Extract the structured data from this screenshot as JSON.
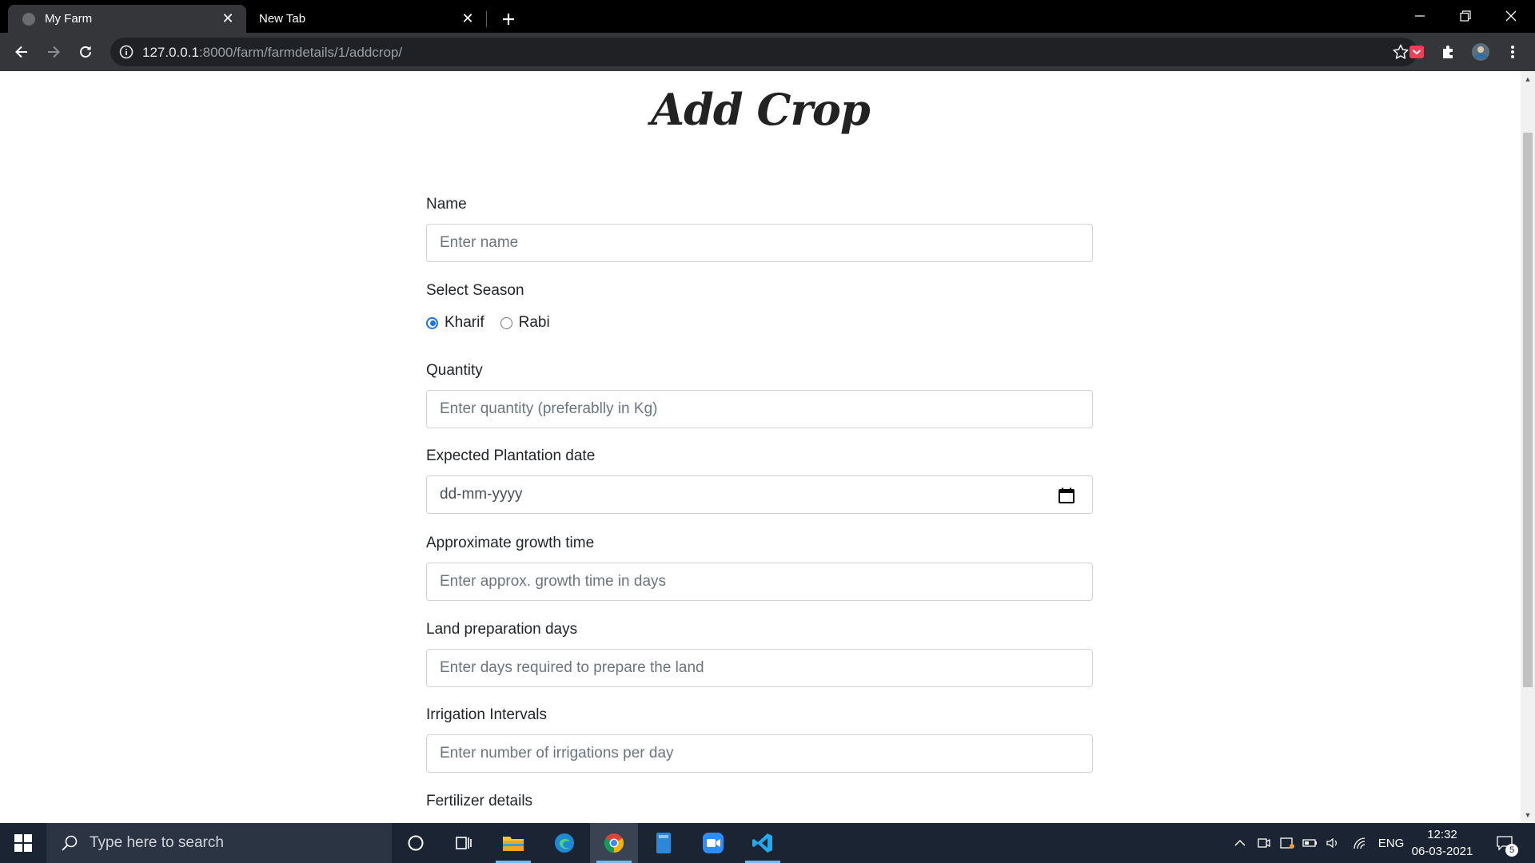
{
  "browser": {
    "tabs": [
      {
        "title": "My Farm",
        "active": true
      },
      {
        "title": "New Tab",
        "active": false
      }
    ],
    "url_host": "127.0.0.1",
    "url_rest": ":8000/farm/farmdetails/1/addcrop/"
  },
  "page": {
    "title": "Add Crop",
    "fields": {
      "name": {
        "label": "Name",
        "placeholder": "Enter name"
      },
      "season": {
        "label": "Select Season",
        "options": [
          "Kharif",
          "Rabi"
        ],
        "selected": "Kharif"
      },
      "quantity": {
        "label": "Quantity",
        "placeholder": "Enter quantity (preferablly in Kg)"
      },
      "plantation_date": {
        "label": "Expected Plantation date",
        "placeholder": "dd-mm-yyyy"
      },
      "growth_time": {
        "label": "Approximate growth time",
        "placeholder": "Enter approx. growth time in days"
      },
      "land_prep": {
        "label": "Land preparation days",
        "placeholder": "Enter days required to prepare the land"
      },
      "irrigation": {
        "label": "Irrigation Intervals",
        "placeholder": "Enter number of irrigations per day"
      },
      "fertilizer": {
        "label": "Fertilizer details"
      }
    }
  },
  "taskbar": {
    "search_placeholder": "Type here to search",
    "language": "ENG",
    "time": "12:32",
    "date": "06-03-2021",
    "notification_count": "5"
  },
  "colors": {
    "accent": "#1a73e8",
    "taskbar": "#1b2432",
    "chrome": "#35363a"
  }
}
